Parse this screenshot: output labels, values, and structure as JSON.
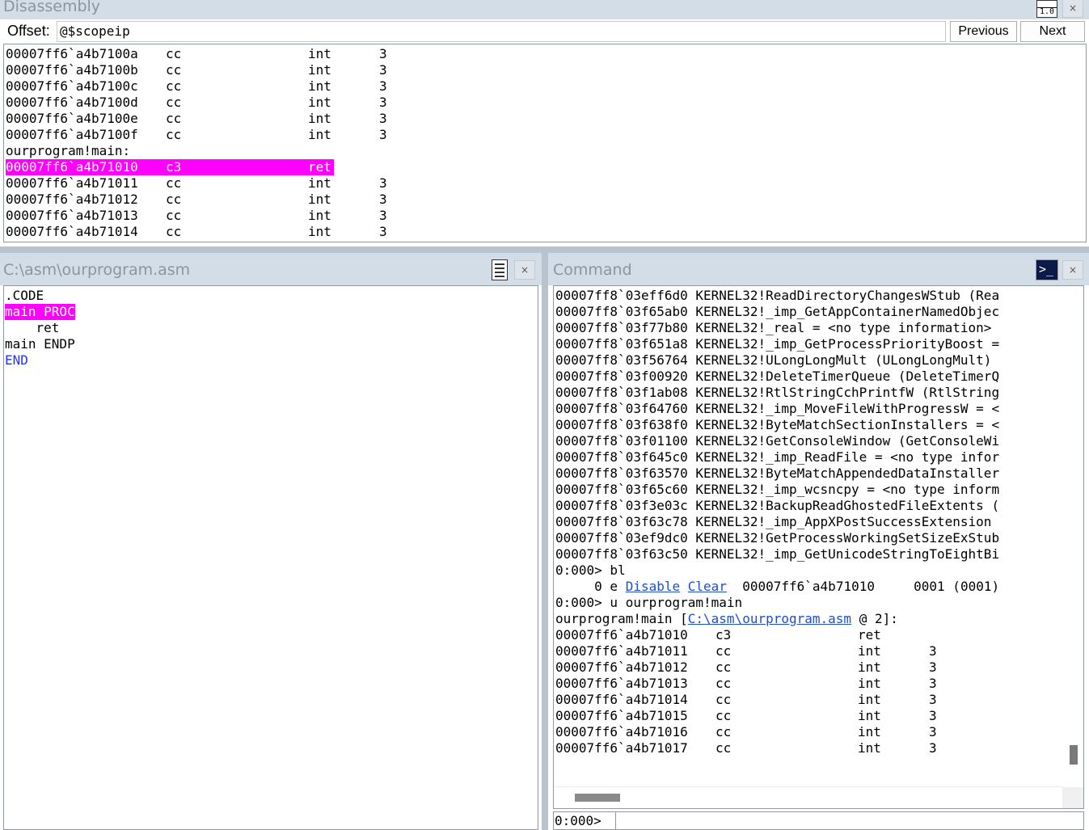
{
  "disassembly": {
    "title": "Disassembly",
    "offset_label": "Offset:",
    "offset_value": "@$scopeip",
    "prev_label": "Previous",
    "next_label": "Next",
    "icon": "version-1-0-icon",
    "close": "×",
    "lines": [
      {
        "addr": "00007ff6`a4b7100a",
        "bytes": "cc",
        "op": "int",
        "arg": "3"
      },
      {
        "addr": "00007ff6`a4b7100b",
        "bytes": "cc",
        "op": "int",
        "arg": "3"
      },
      {
        "addr": "00007ff6`a4b7100c",
        "bytes": "cc",
        "op": "int",
        "arg": "3"
      },
      {
        "addr": "00007ff6`a4b7100d",
        "bytes": "cc",
        "op": "int",
        "arg": "3"
      },
      {
        "addr": "00007ff6`a4b7100e",
        "bytes": "cc",
        "op": "int",
        "arg": "3"
      },
      {
        "addr": "00007ff6`a4b7100f",
        "bytes": "cc",
        "op": "int",
        "arg": "3"
      }
    ],
    "symbol_label": "ourprogram!main:",
    "current_line": {
      "addr": "00007ff6`a4b71010",
      "bytes": "c3",
      "op": "ret",
      "arg": ""
    },
    "lines_after": [
      {
        "addr": "00007ff6`a4b71011",
        "bytes": "cc",
        "op": "int",
        "arg": "3"
      },
      {
        "addr": "00007ff6`a4b71012",
        "bytes": "cc",
        "op": "int",
        "arg": "3"
      },
      {
        "addr": "00007ff6`a4b71013",
        "bytes": "cc",
        "op": "int",
        "arg": "3"
      },
      {
        "addr": "00007ff6`a4b71014",
        "bytes": "cc",
        "op": "int",
        "arg": "3"
      }
    ]
  },
  "source": {
    "title": "C:\\asm\\ourprogram.asm",
    "close": "×",
    "lines": [
      ".CODE",
      "main PROC",
      "    ret",
      "main ENDP",
      "END"
    ]
  },
  "command": {
    "title": "Command",
    "close": "×",
    "output": [
      "00007ff8`03eff6d0 KERNEL32!ReadDirectoryChangesWStub (Rea",
      "00007ff8`03f65ab0 KERNEL32!_imp_GetAppContainerNamedObjec",
      "00007ff8`03f77b80 KERNEL32!_real = <no type information>",
      "00007ff8`03f651a8 KERNEL32!_imp_GetProcessPriorityBoost =",
      "00007ff8`03f56764 KERNEL32!ULongLongMult (ULongLongMult)",
      "00007ff8`03f00920 KERNEL32!DeleteTimerQueue (DeleteTimerQ",
      "00007ff8`03f1ab08 KERNEL32!RtlStringCchPrintfW (RtlString",
      "00007ff8`03f64760 KERNEL32!_imp_MoveFileWithProgressW = <",
      "00007ff8`03f638f0 KERNEL32!ByteMatchSectionInstallers = <",
      "00007ff8`03f01100 KERNEL32!GetConsoleWindow (GetConsoleWi",
      "00007ff8`03f645c0 KERNEL32!_imp_ReadFile = <no type infor",
      "00007ff8`03f63570 KERNEL32!ByteMatchAppendedDataInstaller",
      "00007ff8`03f65c60 KERNEL32!_imp_wcsncpy = <no type inform",
      "00007ff8`03f3e03c KERNEL32!BackupReadGhostedFileExtents (",
      "00007ff8`03f63c78 KERNEL32!_imp_AppXPostSuccessExtension",
      "00007ff8`03ef9dc0 KERNEL32!GetProcessWorkingSetSizeExStub",
      "00007ff8`03f63c50 KERNEL32!_imp_GetUnicodeStringToEightBi",
      "0:000> bl"
    ],
    "bp_line": {
      "prefix": "     0 e ",
      "disable": "Disable",
      "clear": "Clear",
      "suffix": "  00007ff6`a4b71010     0001 (0001)"
    },
    "cmd2": "0:000> u ourprogram!main",
    "src_line": {
      "prefix": "ourprogram!main [",
      "link": "C:\\asm\\ourprogram.asm",
      "suffix": " @ 2]:"
    },
    "disasm": [
      {
        "addr": "00007ff6`a4b71010",
        "bytes": "c3",
        "op": "ret",
        "arg": ""
      },
      {
        "addr": "00007ff6`a4b71011",
        "bytes": "cc",
        "op": "int",
        "arg": "3"
      },
      {
        "addr": "00007ff6`a4b71012",
        "bytes": "cc",
        "op": "int",
        "arg": "3"
      },
      {
        "addr": "00007ff6`a4b71013",
        "bytes": "cc",
        "op": "int",
        "arg": "3"
      },
      {
        "addr": "00007ff6`a4b71014",
        "bytes": "cc",
        "op": "int",
        "arg": "3"
      },
      {
        "addr": "00007ff6`a4b71015",
        "bytes": "cc",
        "op": "int",
        "arg": "3"
      },
      {
        "addr": "00007ff6`a4b71016",
        "bytes": "cc",
        "op": "int",
        "arg": "3"
      },
      {
        "addr": "00007ff6`a4b71017",
        "bytes": "cc",
        "op": "int",
        "arg": "3"
      }
    ],
    "prompt": "0:000>",
    "input_value": ""
  },
  "colors": {
    "highlight": "#ff00ff",
    "keyword": "#2233ff",
    "link": "#1f4fc4"
  }
}
